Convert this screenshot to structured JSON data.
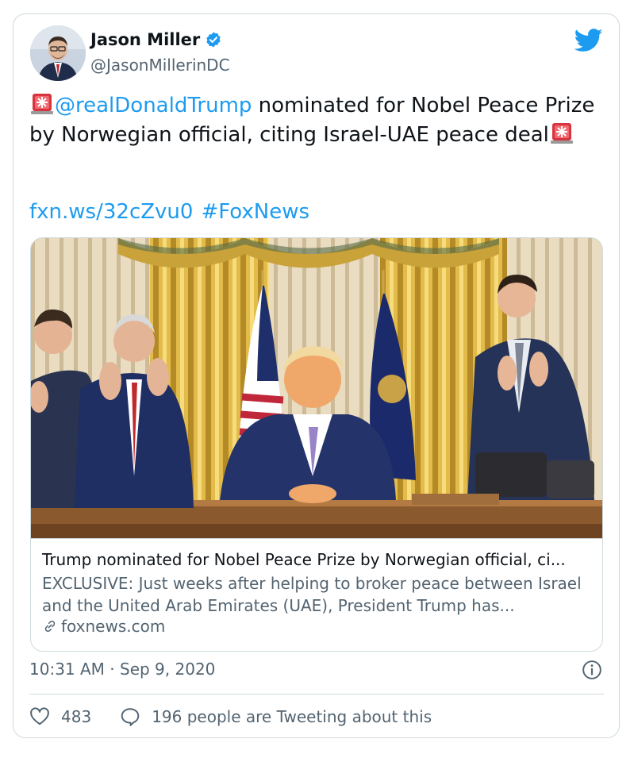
{
  "tweet": {
    "author_name": "Jason Miller",
    "author_handle": "@JasonMillerinDC",
    "mention": "@realDonaldTrump",
    "text_body": " nominated for Nobel Peace Prize by Norwegian official, citing Israel-UAE peace deal",
    "link": "fxn.ws/32cZvu0",
    "hashtag": "#FoxNews"
  },
  "link_card": {
    "title": "Trump nominated for Nobel Peace Prize by Norwegian official, ci...",
    "description": "EXCLUSIVE: Just weeks after helping to broker peace between Israel and the United Arab Emirates (UAE), President Trump has...",
    "domain": "foxnews.com"
  },
  "meta": {
    "timestamp": "10:31 AM · Sep 9, 2020",
    "likes": "483",
    "tweeting_about": "196 people are Tweeting about this"
  },
  "icons": {
    "verified": "verified-badge-icon",
    "brand": "twitter-bird-icon",
    "siren": "siren-emoji-icon",
    "link": "link-icon",
    "info": "info-icon",
    "heart": "heart-icon",
    "reply": "speech-bubble-icon"
  },
  "colors": {
    "accent": "#1d9bf0",
    "text_primary": "#0f1419",
    "text_secondary": "#536471",
    "border": "#cfd9de"
  }
}
